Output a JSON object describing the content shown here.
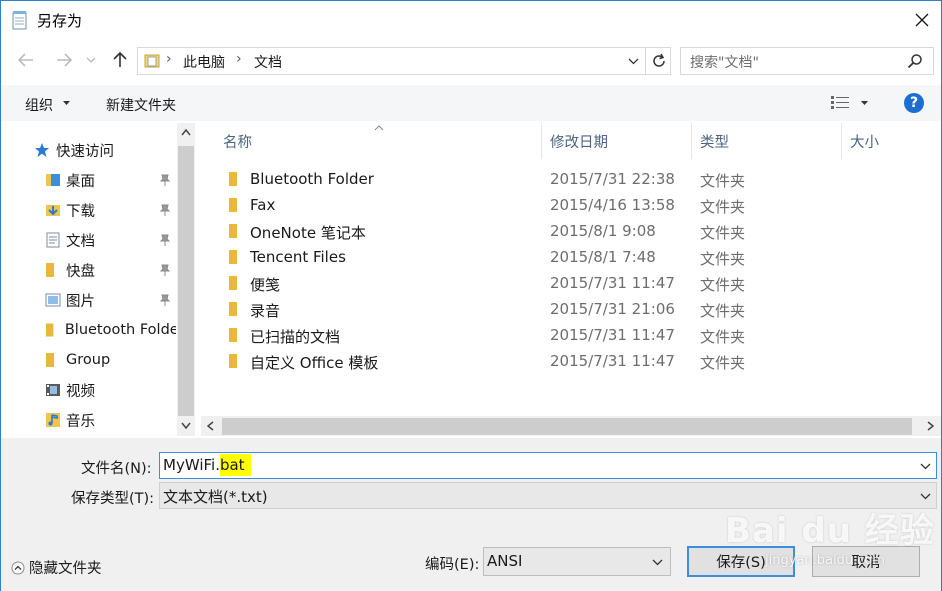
{
  "window": {
    "title": "另存为",
    "close_glyph": "✕"
  },
  "address": {
    "path": [
      "此电脑",
      "文档"
    ],
    "separator": "›",
    "search_placeholder": "搜索\"文档\""
  },
  "toolbar": {
    "organize": "组织",
    "new_folder": "新建文件夹",
    "help_glyph": "?"
  },
  "sidebar": {
    "items": [
      {
        "label": "快速访问",
        "icon": "star-icon",
        "pinned": false
      },
      {
        "label": "桌面",
        "icon": "desktop-icon",
        "pinned": true
      },
      {
        "label": "下载",
        "icon": "download-icon",
        "pinned": true
      },
      {
        "label": "文档",
        "icon": "documents-icon",
        "pinned": true
      },
      {
        "label": "快盘",
        "icon": "folder-icon",
        "pinned": true
      },
      {
        "label": "图片",
        "icon": "pictures-icon",
        "pinned": true
      },
      {
        "label": "Bluetooth Folder",
        "icon": "folder-icon",
        "pinned": false
      },
      {
        "label": "Group",
        "icon": "folder-icon",
        "pinned": false
      },
      {
        "label": "视频",
        "icon": "video-icon",
        "pinned": false
      },
      {
        "label": "音乐",
        "icon": "music-icon",
        "pinned": false
      }
    ]
  },
  "columns": {
    "name": "名称",
    "date": "修改日期",
    "type": "类型",
    "size": "大小"
  },
  "files": [
    {
      "name": "Bluetooth Folder",
      "date": "2015/7/31 22:38",
      "type": "文件夹"
    },
    {
      "name": "Fax",
      "date": "2015/4/16 13:58",
      "type": "文件夹"
    },
    {
      "name": "OneNote 笔记本",
      "date": "2015/8/1 9:08",
      "type": "文件夹"
    },
    {
      "name": "Tencent Files",
      "date": "2015/8/1 7:48",
      "type": "文件夹"
    },
    {
      "name": "便笺",
      "date": "2015/7/31 11:47",
      "type": "文件夹"
    },
    {
      "name": "录音",
      "date": "2015/7/31 21:06",
      "type": "文件夹"
    },
    {
      "name": "已扫描的文档",
      "date": "2015/7/31 11:47",
      "type": "文件夹"
    },
    {
      "name": "自定义 Office 模板",
      "date": "2015/7/31 11:47",
      "type": "文件夹"
    }
  ],
  "form": {
    "filename_label": "文件名(N):",
    "filename_base": "MyWiFi.",
    "filename_ext": "bat",
    "filetype_label": "保存类型(T):",
    "filetype_value": "文本文档(*.txt)",
    "encoding_label": "编码(E):",
    "encoding_value": "ANSI",
    "hide_folders": "隐藏文件夹",
    "save_button": "保存(S)",
    "cancel_button": "取消"
  },
  "watermark": {
    "brand": "Bai du 经验",
    "url": "jingyan.baidu.com"
  },
  "colors": {
    "accent": "#3c8fe0",
    "highlight": "#ffff00",
    "folder": "#e8b83a"
  }
}
